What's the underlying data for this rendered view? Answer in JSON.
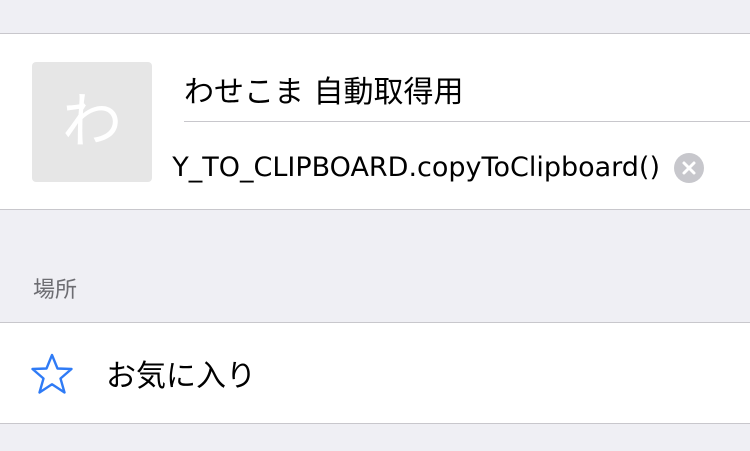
{
  "bookmark": {
    "thumbnail_letter": "わ",
    "title": "わせこま 自動取得用",
    "url": "Y_TO_CLIPBOARD.copyToClipboard()"
  },
  "location_section": {
    "header": "場所",
    "folder_label": "お気に入り"
  },
  "icons": {
    "clear": "clear-icon",
    "folder": "star-icon"
  },
  "colors": {
    "accent": "#2f7bf6",
    "background": "#efeff4",
    "separator": "#c8c7cc",
    "section_header": "#6d6d72",
    "clear_button": "#c7c7cc"
  }
}
